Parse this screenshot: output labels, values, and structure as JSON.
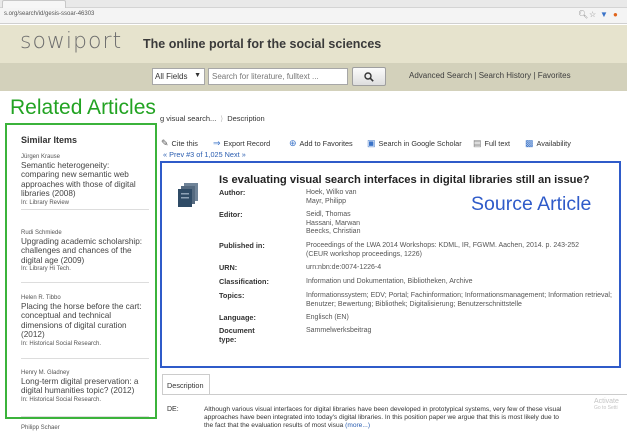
{
  "browser": {
    "url": "s.org/search/id/gesis-ssoar-46303"
  },
  "header": {
    "logo": "sowiport",
    "tagline": "The online portal for the social sciences"
  },
  "search": {
    "field_select": "All Fields",
    "placeholder": "Search for literature, fulltext ...",
    "links": [
      "Advanced Search",
      "Search History",
      "Favorites"
    ],
    "link_separator": " | "
  },
  "annotations": {
    "related_articles": "Related Articles",
    "related_color": "#3bb33b",
    "source_article": "Source Article",
    "source_color": "#2f5bc9"
  },
  "breadcrumb": {
    "items": [
      "g visual search...",
      "Description"
    ]
  },
  "sidebar": {
    "title": "Similar Items",
    "items": [
      {
        "author": "Jürgen Krause",
        "title_lines": [
          "Semantic heterogeneity:",
          "comparing new semantic web",
          "approaches with those of digital",
          "libraries (2008)"
        ],
        "source": "In: Library Review"
      },
      {
        "author": "Rudi Schmiede",
        "title_lines": [
          "Upgrading academic scholarship:",
          "challenges and chances of the",
          "digital age (2009)"
        ],
        "source": "In: Library Hi Tech."
      },
      {
        "author": "Helen R. Tibbo",
        "title_lines": [
          "Placing the horse before the cart:",
          "conceptual and technical",
          "dimensions of digital curation",
          "(2012)"
        ],
        "source": "In: Historical Social Research."
      },
      {
        "author": "Henry M. Gladney",
        "title_lines": [
          "Long-term digital preservation: a",
          "digital humanities topic? (2012)"
        ],
        "source": "In: Historical Social Research."
      },
      {
        "author": "Philipp Schaer",
        "title_lines": [],
        "source": ""
      }
    ]
  },
  "toolbar": {
    "cite": "Cite this",
    "export": "Export Record",
    "favorites": "Add to Favorites",
    "scholar": "Search in Google Scholar",
    "fulltext": "Full text",
    "availability": "Availability"
  },
  "pager": "« Prev #3 of 1,025 Next »",
  "article": {
    "title": "Is evaluating visual search interfaces in digital libraries still an issue?",
    "fields": [
      {
        "label": "Author:",
        "lines": [
          "Hoek, Wilko van",
          "Mayr, Philipp"
        ]
      },
      {
        "label": "Editor:",
        "lines": [
          "Seidl, Thomas",
          "Hassani, Marwan",
          "Beecks, Christian"
        ]
      },
      {
        "label": "Published in:",
        "lines": [
          "Proceedings of the LWA 2014 Workshops: KDML, IR, FGWM. Aachen, 2014. p. 243-252",
          "(CEUR workshop proceedings, 1226)"
        ]
      },
      {
        "label": "URN:",
        "lines": [
          "urn:nbn:de:0074-1226-4"
        ]
      },
      {
        "label": "Classification:",
        "lines": [
          "Information und Dokumentation, Bibliotheken, Archive"
        ]
      },
      {
        "label": "Topics:",
        "lines": [
          "Informationssystem; EDV; Portal; Fachinformation; Informationsmanagement; Information retrieval;",
          "Benutzer; Bewertung; Bibliothek; Digitalisierung; Benutzerschnittstelle"
        ]
      },
      {
        "label": "Language:",
        "lines": [
          "Englisch (EN)"
        ]
      },
      {
        "label": "Document type:",
        "lines": [
          "Sammelwerksbeitrag"
        ]
      }
    ]
  },
  "description": {
    "tab": "Description",
    "lang": "DE:",
    "lines": [
      "Although various visual interfaces for digital libraries have been developed in prototypical systems, very few of these visual",
      "approaches have been integrated into today's digital libraries. In this position paper we argue that this is most likely due to",
      "the fact that the evaluation results of most visua"
    ],
    "more": "(more...)"
  },
  "watermark": {
    "line1": "Activate",
    "line2": "Go to Setti"
  },
  "colors": {
    "header_bg": "#e6e3cd",
    "searchbar_bg": "#d3d1bb"
  }
}
